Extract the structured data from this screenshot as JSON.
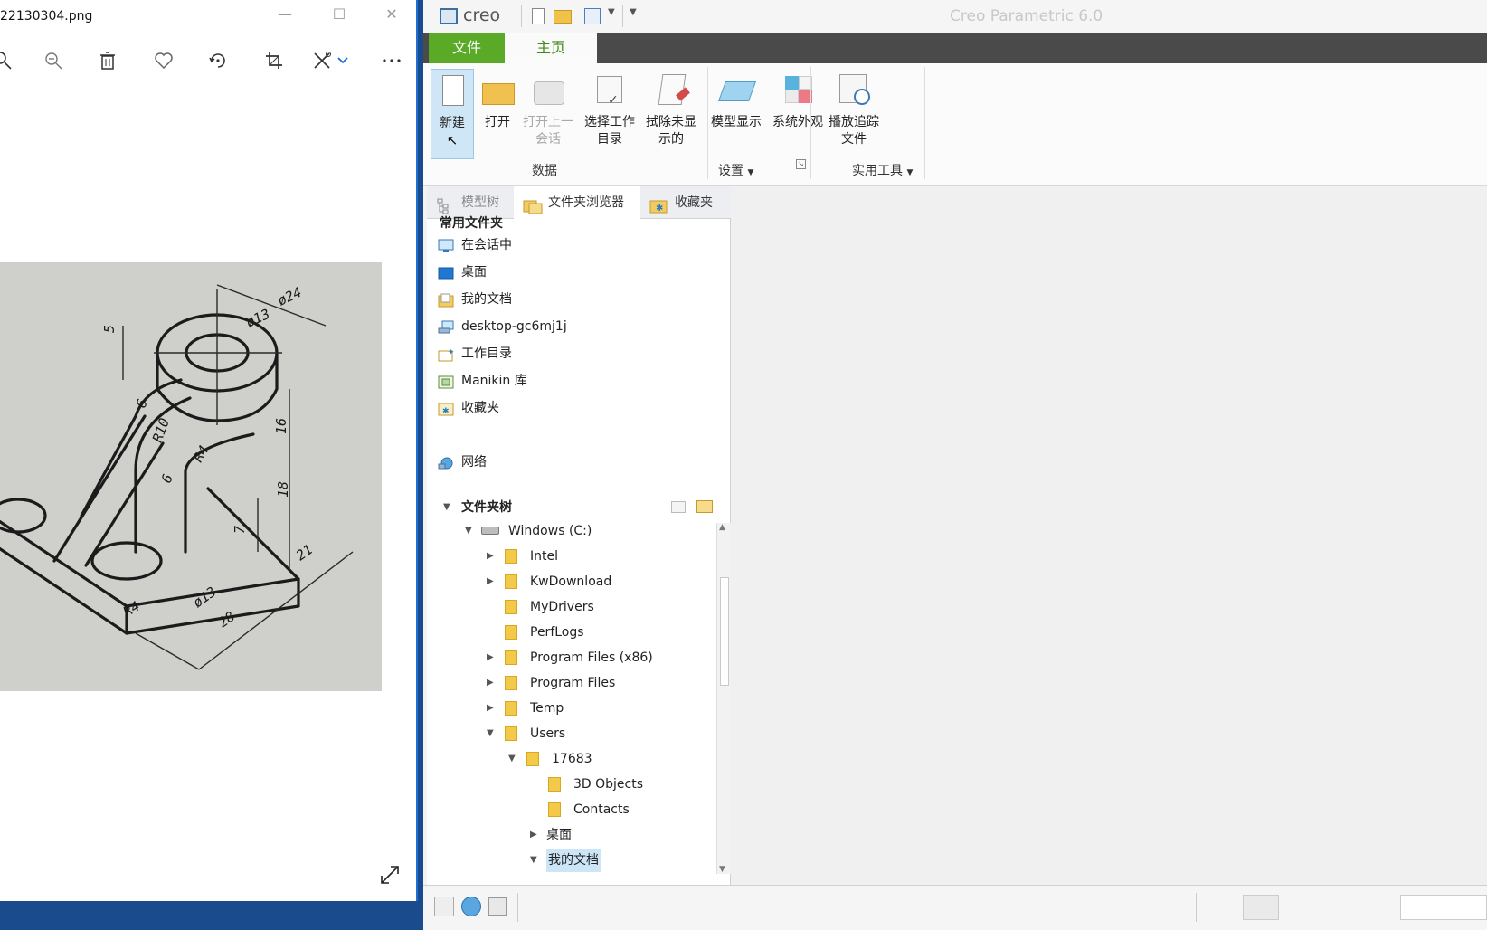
{
  "viewer": {
    "filename": "22130304.png",
    "toolbar_icons": [
      "zoom-in-icon",
      "zoom-out-icon",
      "delete-icon",
      "favorite-icon",
      "rotate-icon",
      "crop-icon",
      "edit-icon",
      "more-icon"
    ],
    "dimension_labels": [
      "ø24",
      "ø13",
      "5",
      "6",
      "R10",
      "16",
      "R4",
      "18",
      "6",
      "7",
      "ø13",
      "28",
      "21",
      "R4"
    ]
  },
  "creo": {
    "logo": "creo",
    "app_title": "Creo Parametric 6.0",
    "tabs": {
      "file": "文件",
      "home": "主页"
    },
    "ribbon": {
      "new": "新建",
      "open": "打开",
      "open_last_line1": "打开上一",
      "open_last_line2": "会话",
      "select_wd_line1": "选择工作",
      "select_wd_line2": "目录",
      "erase_line1": "拭除未显",
      "erase_line2": "示的",
      "model_display": "模型显示",
      "system_appearance": "系统外观",
      "playback_line1": "播放追踪",
      "playback_line2": "文件",
      "group_data": "数据",
      "group_settings": "设置",
      "group_utilities": "实用工具"
    },
    "navigator": {
      "tabs": {
        "model_tree": "模型树",
        "folder_browser": "文件夹浏览器",
        "favorites": "收藏夹"
      },
      "common_header": "常用文件夹",
      "common": [
        "在会话中",
        "桌面",
        "我的文档",
        "desktop-gc6mj1j",
        "工作目录",
        "Manikin 库",
        "收藏夹"
      ],
      "network": "网络",
      "tree_header": "文件夹树",
      "tree": {
        "root": "Windows (C:)",
        "intel": "Intel",
        "kwdownload": "KwDownload",
        "mydrivers": "MyDrivers",
        "perflogs": "PerfLogs",
        "pf86": "Program Files (x86)",
        "pf": "Program Files",
        "temp": "Temp",
        "users": "Users",
        "u17683": "17683",
        "objects3d": "3D Objects",
        "contacts": "Contacts",
        "desktop": "桌面",
        "mydocs": "我的文档"
      }
    }
  }
}
